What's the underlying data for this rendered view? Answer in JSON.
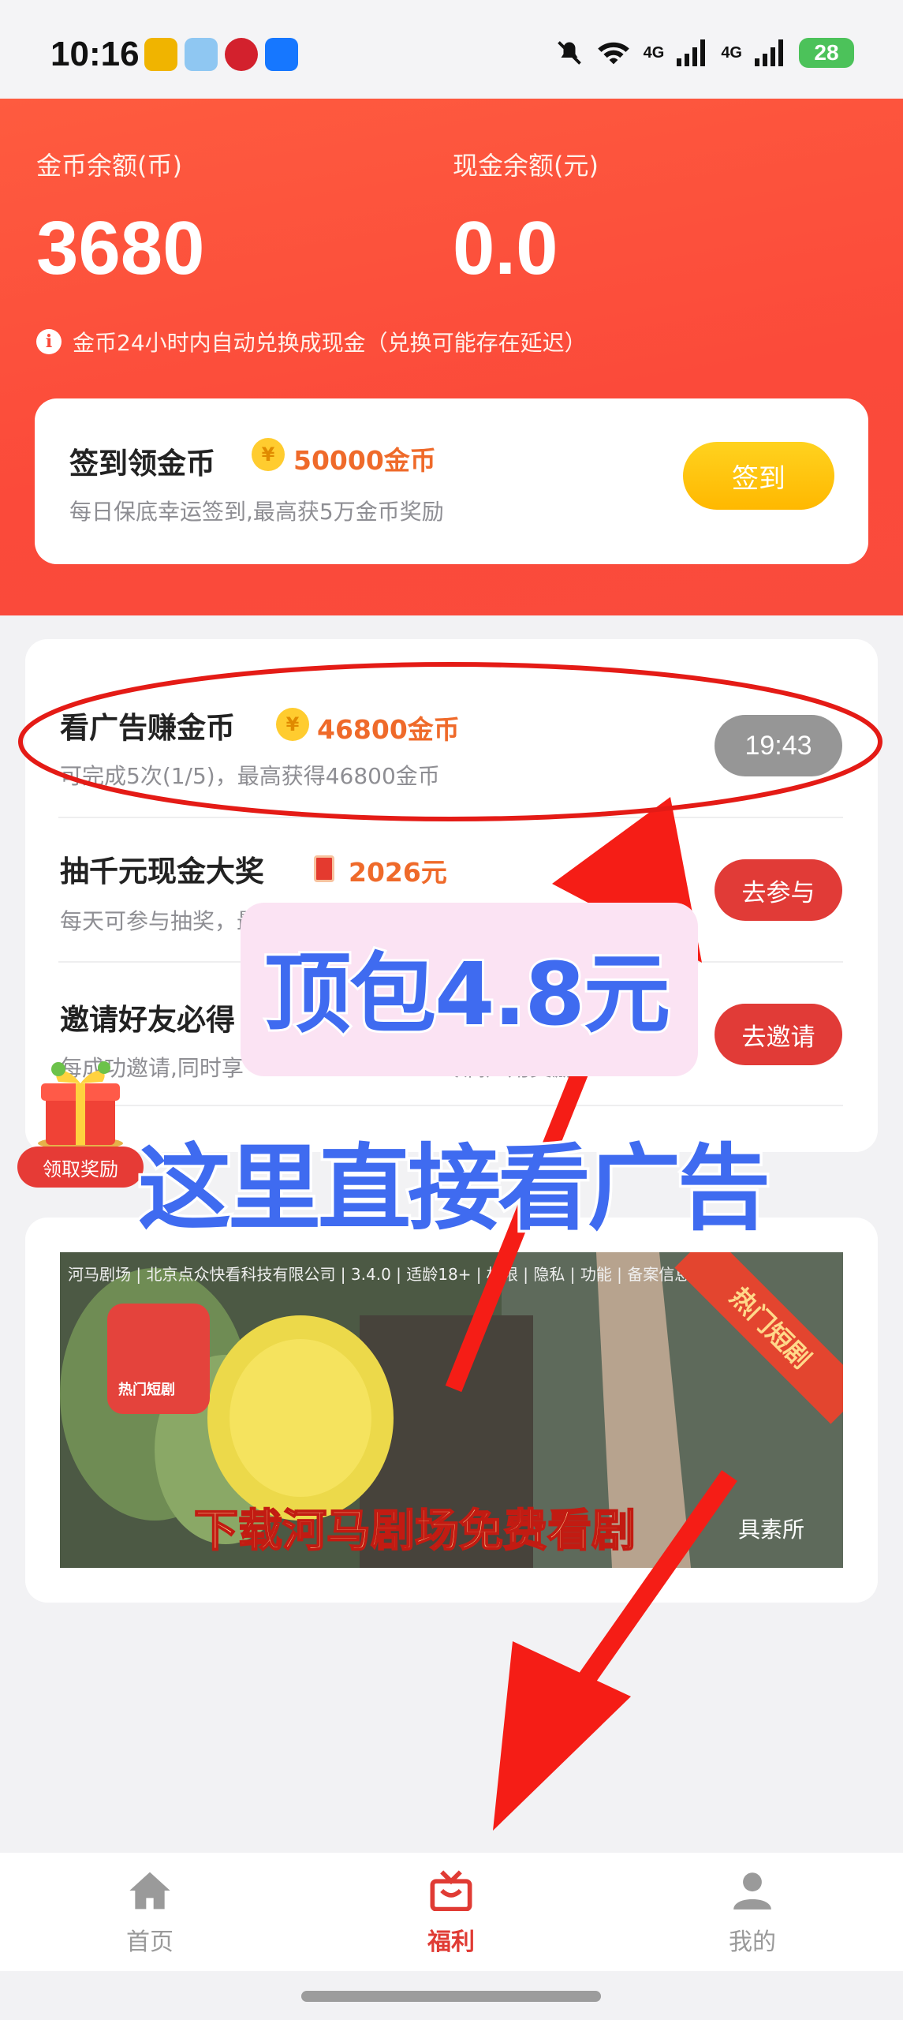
{
  "status_bar": {
    "time": "10:16",
    "network_1": "4G",
    "network_2": "4G",
    "battery": "28"
  },
  "balances": {
    "coin_label": "金币余额(币)",
    "coin_value": "3680",
    "cash_label": "现金余额(元)",
    "cash_value": "0.0",
    "note": "金币24小时内自动兑换成现金（兑换可能存在延迟）"
  },
  "signin": {
    "title": "签到领金币",
    "coin_symbol": "¥",
    "reward": "50000金币",
    "subtitle": "每日保底幸运签到,最高获5万金币奖励",
    "button": "签到"
  },
  "tasks": [
    {
      "title": "看广告赚金币",
      "reward_icon": "coin-icon",
      "reward": "46800金币",
      "subtitle": "可完成5次(1/5)，最高获得46800金币",
      "button": "19:43",
      "button_state": "countdown"
    },
    {
      "title": "抽千元现金大奖",
      "reward_icon": "red-packet-icon",
      "reward": "2026元",
      "subtitle": "每天可参与抽奖，最高可得2026现金奖励",
      "button": "去参与",
      "button_state": "active"
    },
    {
      "title": "邀请好友必得",
      "reward_icon": "",
      "reward": "",
      "subtitle": "每成功邀请,同时享",
      "subtitle_tail": "专属应用奖励!",
      "button": "去邀请",
      "button_state": "active"
    }
  ],
  "float_reward": {
    "label": "领取奖励"
  },
  "ad": {
    "meta": "河马剧场 | 北京点众快看科技有限公司 | 3.4.0 | 适龄18+ | 权限 | 隐私 | 功能 | 备案信息",
    "logo_text": "热门短剧",
    "ribbon": "热门短剧",
    "caption": "下载河马剧场免费看剧",
    "caption_tail": "具素所"
  },
  "overlays": {
    "text_1": "顶包4.8元",
    "text_2": "这里直接看广告"
  },
  "nav": [
    {
      "label": "首页",
      "icon": "home-icon",
      "active": false
    },
    {
      "label": "福利",
      "icon": "gift-icon",
      "active": true
    },
    {
      "label": "我的",
      "icon": "user-icon",
      "active": false
    }
  ],
  "colors": {
    "header_red": "#fb4a3a",
    "accent_red": "#e13b37",
    "coin_gold": "#ffcc2f",
    "reward_orange": "#ef6a2a",
    "overlay_blue": "#3f6bf0"
  }
}
